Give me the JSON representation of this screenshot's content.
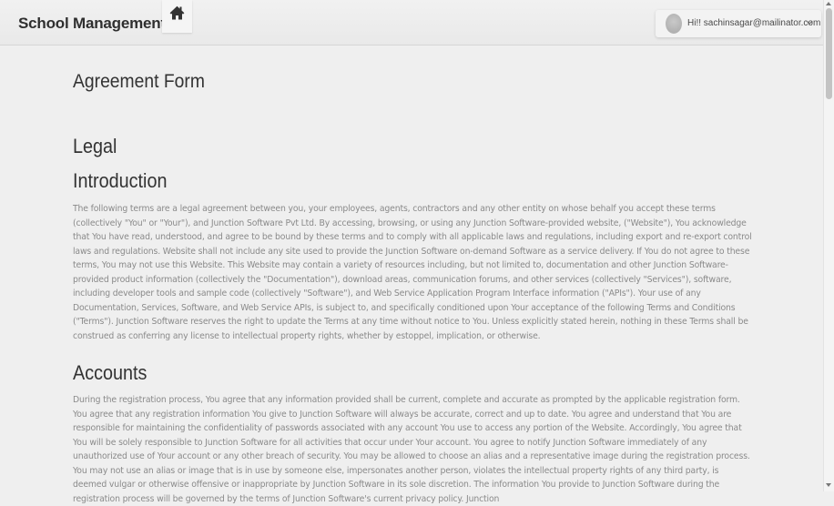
{
  "header": {
    "brand": "School Management",
    "home_icon": "home-icon",
    "user_greeting": "Hi!! sachinsagar@mailinator.com"
  },
  "page": {
    "title": "Agreement Form",
    "legal_heading": "Legal",
    "intro_heading": "Introduction",
    "intro_text": "The following terms are a legal agreement between you, your employees, agents, contractors and any other entity on whose behalf you accept these terms (collectively \"You\" or \"Your\"), and Junction Software Pvt Ltd. By accessing, browsing, or using any Junction Software-provided website, (\"Website\"), You acknowledge that You have read, understood, and agree to be bound by these terms and to comply with all applicable laws and regulations, including export and re-export control laws and regulations. Website shall not include any site used to provide the Junction Software on-demand Software as a service delivery. If You do not agree to these terms, You may not use this Website. This Website may contain a variety of resources including, but not limited to, documentation and other Junction Software-provided product information (collectively the \"Documentation\"), download areas, communication forums, and other services (collectively \"Services\"), software, including developer tools and sample code (collectively \"Software\"), and Web Service Application Program Interface information (\"APIs\"). Your use of any Documentation, Services, Software, and Web Service APIs, is subject to, and specifically conditioned upon Your acceptance of the following Terms and Conditions (\"Terms\"). Junction Software reserves the right to update the Terms at any time without notice to You. Unless explicitly stated herein, nothing in these Terms shall be construed as conferring any license to intellectual property rights, whether by estoppel, implication, or otherwise.",
    "accounts_heading": "Accounts",
    "accounts_text": "During the registration process, You agree that any information provided shall be current, complete and accurate as prompted by the applicable registration form. You agree that any registration information You give to Junction Software will always be accurate, correct and up to date. You agree and understand that You are responsible for maintaining the confidentiality of passwords associated with any account You use to access any portion of the Website. Accordingly, You agree that You will be solely responsible to Junction Software for all activities that occur under Your account. You agree to notify Junction Software immediately of any unauthorized use of Your account or any other breach of security. You may be allowed to choose an alias and a representative image during the registration process. You may not use an alias or image that is in use by someone else, impersonates another person, violates the intellectual property rights of any third party, is deemed vulgar or otherwise offensive or inappropriate by Junction Software in its sole discretion. The information You provide to Junction Software during the registration process will be governed by the terms of Junction Software's current privacy policy. Junction"
  }
}
